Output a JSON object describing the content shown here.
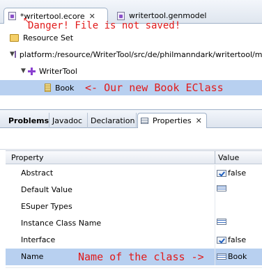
{
  "editor": {
    "tabs": [
      {
        "label": "*writertool.ecore",
        "active": true
      },
      {
        "label": "writertool.genmodel",
        "active": false
      }
    ],
    "unsaved_note": "Danger! File is not saved!",
    "tree": {
      "root_label": "Resource Set",
      "resource_label": "platform:/resource/WriterTool/src/de/philmanndark/writertool/m",
      "package_label": "WriterTool",
      "class_label": "Book"
    },
    "class_note": "<- Our new Book EClass"
  },
  "views": {
    "tabs": [
      "Problems",
      "Javadoc",
      "Declaration",
      "Properties"
    ]
  },
  "properties": {
    "columns": [
      "Property",
      "Value"
    ],
    "rows": [
      {
        "name": "Abstract",
        "value": "false",
        "icon": "checkbox-icon"
      },
      {
        "name": "Default Value",
        "value": "",
        "icon": "list-icon"
      },
      {
        "name": "ESuper Types",
        "value": "",
        "icon": ""
      },
      {
        "name": "Instance Class Name",
        "value": "",
        "icon": "list-icon"
      },
      {
        "name": "Interface",
        "value": "false",
        "icon": "checkbox-icon"
      },
      {
        "name": "Name",
        "value": "Book",
        "icon": "list-icon"
      }
    ],
    "name_note": "Name of the class ->"
  },
  "colors": {
    "annotation": "#e11a1a",
    "selection": "#b8d0f0"
  }
}
